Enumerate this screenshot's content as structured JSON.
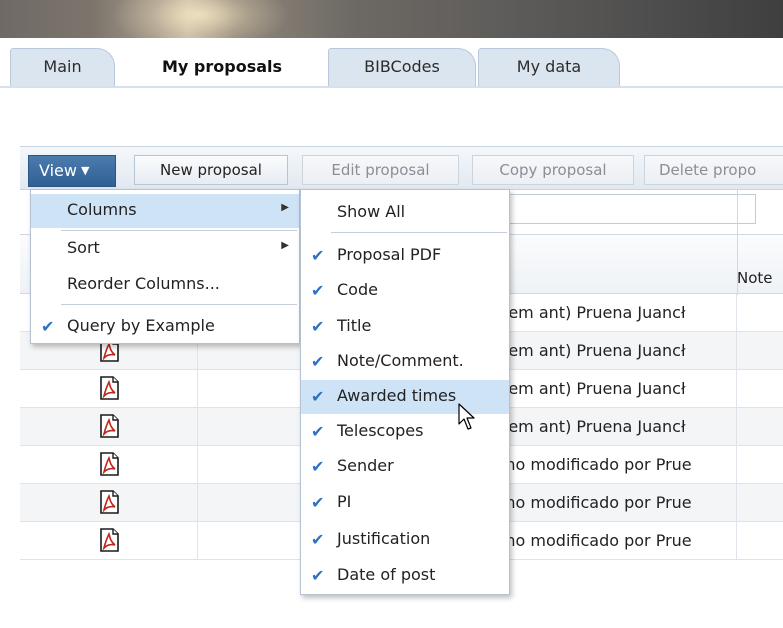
{
  "tabs": [
    {
      "label": "Main",
      "active": false
    },
    {
      "label": "My proposals",
      "active": true
    },
    {
      "label": "BIBCodes",
      "active": false
    },
    {
      "label": "My data",
      "active": false
    }
  ],
  "toolbar": {
    "view_label": "View",
    "new_proposal": "New proposal",
    "edit_proposal": "Edit proposal",
    "copy_proposal": "Copy proposal",
    "delete_proposal": "Delete propo"
  },
  "grid": {
    "note_header": "Note",
    "rows": [
      {
        "title": "sem ant) Pruena Juancł"
      },
      {
        "title": "sem ant) Pruena Juancł"
      },
      {
        "title": "sem ant) Pruena Juancł"
      },
      {
        "title": "sem ant) Pruena Juancł"
      },
      {
        "title": ":ho modificado por Prue"
      },
      {
        "title": ":ho modificado por Prue"
      },
      {
        "title": ":ho modificado por Prue"
      }
    ]
  },
  "view_menu": {
    "columns": "Columns",
    "sort": "Sort",
    "reorder": "Reorder Columns...",
    "query": "Query by Example"
  },
  "columns_menu": {
    "show_all": "Show All",
    "items": [
      {
        "label": "Proposal PDF",
        "checked": true
      },
      {
        "label": "Code",
        "checked": true
      },
      {
        "label": "Title",
        "checked": true
      },
      {
        "label": "Note/Comment.",
        "checked": true
      },
      {
        "label": "Awarded times",
        "checked": true
      },
      {
        "label": "Telescopes",
        "checked": true
      },
      {
        "label": "Sender",
        "checked": true
      },
      {
        "label": "PI",
        "checked": true
      },
      {
        "label": "Justification",
        "checked": true
      },
      {
        "label": "Date of post",
        "checked": true
      }
    ]
  },
  "icons": {
    "check": "check-icon",
    "submenu": "submenu-arrow-icon",
    "pdf": "pdf-file-icon",
    "cursor": "mouse-pointer-icon"
  },
  "colors": {
    "highlight": "#cfe3f6",
    "view_button": "#3b6aa0",
    "check": "#2e72c4"
  }
}
